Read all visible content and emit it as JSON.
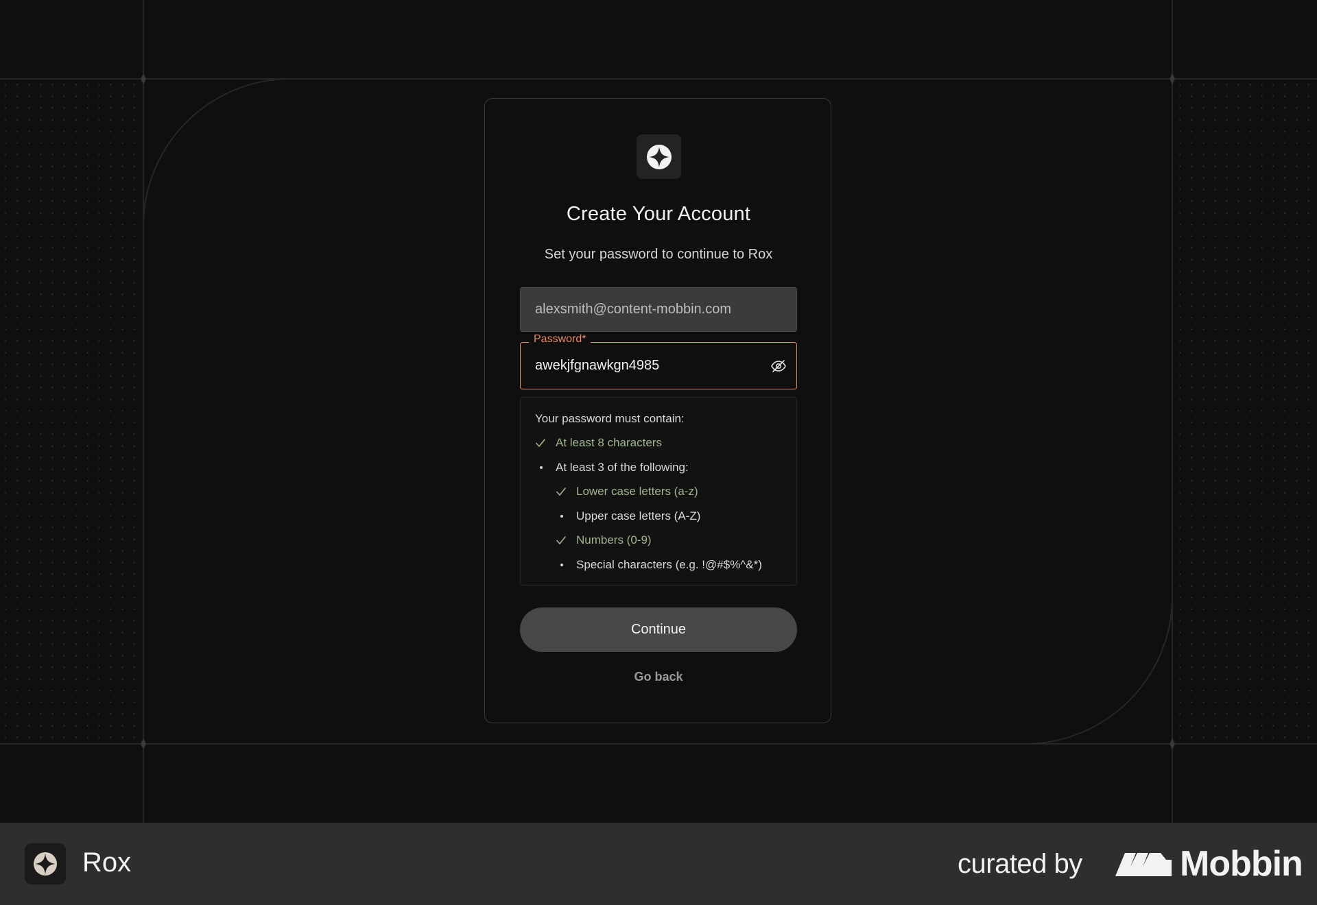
{
  "card": {
    "title": "Create Your Account",
    "subtitle": "Set your password to continue to Rox"
  },
  "email": {
    "value": "alexsmith@content-mobbin.com"
  },
  "password": {
    "label": "Password",
    "required_mark": "*",
    "value": "awekjfgnawkgn4985"
  },
  "requirements": {
    "title": "Your password must contain:",
    "items": [
      {
        "label": "At least 8 characters",
        "met": true
      },
      {
        "label": "At least 3 of the following:",
        "met": false
      },
      {
        "label": "Lower case letters (a-z)",
        "met": true
      },
      {
        "label": "Upper case letters (A-Z)",
        "met": false
      },
      {
        "label": "Numbers (0-9)",
        "met": true
      },
      {
        "label": "Special characters (e.g. !@#$%^&*)",
        "met": false
      }
    ]
  },
  "actions": {
    "continue_label": "Continue",
    "go_back_label": "Go back"
  },
  "footer": {
    "app_name": "Rox",
    "curated_by": "curated by",
    "brand": "Mobbin"
  },
  "icons": {
    "logo": "compass-star-icon",
    "toggle_visibility": "eye-off-icon",
    "met": "check-icon",
    "unmet": "bullet-icon",
    "brand_mark": "mobbin-logo-icon"
  },
  "colors": {
    "accent": "#e8876a",
    "success": "#9fb58e",
    "button": "#474747"
  }
}
